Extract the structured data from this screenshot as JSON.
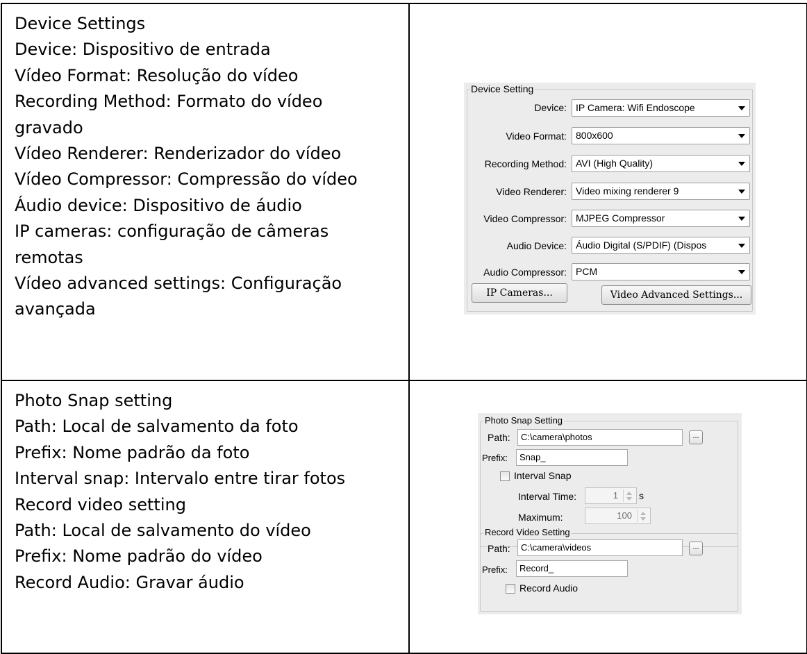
{
  "device_description": [
    "Device Settings",
    "Device: Dispositivo de entrada",
    "Vídeo Format: Resolução do vídeo",
    "Recording Method: Formato do vídeo",
    "gravado",
    "Vídeo Renderer: Renderizador do vídeo",
    "Vídeo Compressor: Compressão do vídeo",
    "Áudio device: Dispositivo de áudio",
    "IP cameras: configuração de câmeras",
    "remotas",
    "Vídeo advanced settings: Configuração",
    "avançada"
  ],
  "snap_description": [
    "Photo Snap setting",
    "Path: Local de salvamento da foto",
    "Prefix: Nome padrão da foto",
    "Interval snap: Intervalo entre tirar fotos",
    "Record video setting",
    "Path: Local de salvamento do vídeo",
    "Prefix: Nome padrão do vídeo",
    "Record Audio: Gravar áudio"
  ],
  "device_panel": {
    "title": "Device Setting",
    "fields": {
      "device": {
        "label": "Device:",
        "value": "IP Camera: Wifi Endoscope"
      },
      "video_format": {
        "label": "Video Format:",
        "value": "800x600"
      },
      "recording_method": {
        "label": "Recording Method:",
        "value": "AVI (High Quality)"
      },
      "video_renderer": {
        "label": "Video Renderer:",
        "value": "Video mixing renderer 9"
      },
      "video_compressor": {
        "label": "Video Compressor:",
        "value": "MJPEG Compressor"
      },
      "audio_device": {
        "label": "Audio Device:",
        "value": "Áudio Digital (S/PDIF) (Dispos"
      },
      "audio_compressor": {
        "label": "Audio Compressor:",
        "value": "PCM"
      }
    },
    "ip_cameras_button": "IP Cameras...",
    "advanced_button": "Video Advanced Settings..."
  },
  "photo_panel": {
    "title": "Photo Snap Setting",
    "path_label": "Path:",
    "path_value": "C:\\camera\\photos",
    "browse_label": "...",
    "prefix_label": "Prefix:",
    "prefix_value": "Snap_",
    "interval_snap_label": "Interval Snap",
    "interval_time_label": "Interval Time:",
    "interval_time_value": "1",
    "interval_unit": "s",
    "maximum_label": "Maximum:",
    "maximum_value": "100"
  },
  "record_panel": {
    "title": "Record Video Setting",
    "path_label": "Path:",
    "path_value": "C:\\camera\\videos",
    "browse_label": "...",
    "prefix_label": "Prefix:",
    "prefix_value": "Record_",
    "record_audio_label": "Record Audio"
  }
}
